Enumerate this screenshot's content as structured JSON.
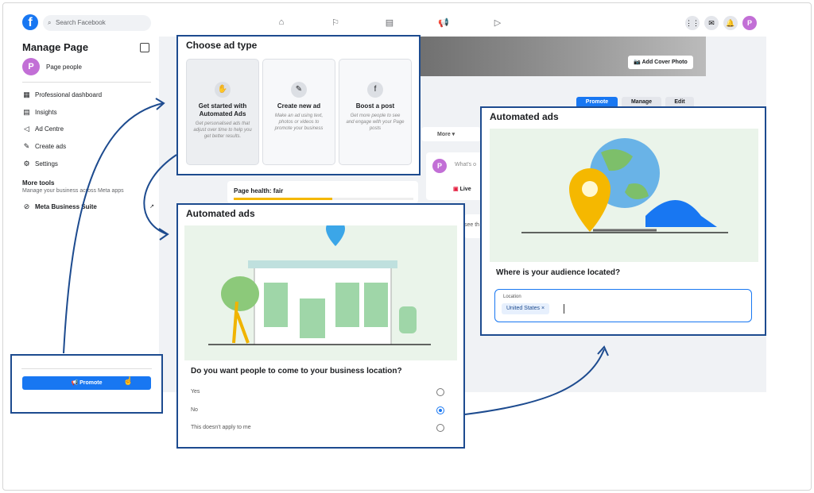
{
  "search": {
    "placeholder": "Search Facebook"
  },
  "topbar": {
    "avatar": "P"
  },
  "sidebar": {
    "title": "Manage Page",
    "page_name": "Page people",
    "avatar": "P",
    "items": [
      {
        "label": "Professional dashboard",
        "icon": "dashboard-icon"
      },
      {
        "label": "Insights",
        "icon": "insights-icon"
      },
      {
        "label": "Ad Centre",
        "icon": "megaphone-icon"
      },
      {
        "label": "Create ads",
        "icon": "edit-icon"
      },
      {
        "label": "Settings",
        "icon": "gear-icon"
      }
    ],
    "more_tools": "More tools",
    "more_tools_sub": "Manage your business across Meta apps",
    "meta_suite": "Meta Business Suite"
  },
  "cover": {
    "add_cover": "Add Cover Photo"
  },
  "header_buttons": {
    "promote": "Promote",
    "manage": "Manage",
    "edit": "Edit"
  },
  "tabs": {
    "more": "More"
  },
  "composer": {
    "placeholder": "What's o",
    "avatar": "P",
    "live": "Live",
    "partial": "see th"
  },
  "page_health": {
    "label": "Page health: fair"
  },
  "choose_ad": {
    "title": "Choose ad type",
    "tiles": [
      {
        "title": "Get started with Automated Ads",
        "desc": "Get personalised ads that adjust over time to help you get better results."
      },
      {
        "title": "Create new ad",
        "desc": "Make an ad using text, photos or videos to promote your business"
      },
      {
        "title": "Boost a post",
        "desc": "Get more people to see and engage with your Page posts"
      }
    ]
  },
  "automated_left": {
    "title": "Automated ads",
    "question": "Do you want people to come to your business location?",
    "options": [
      "Yes",
      "No",
      "This doesn't apply to me"
    ],
    "selected": "No"
  },
  "automated_right": {
    "title": "Automated ads",
    "question": "Where is your audience located?",
    "location_label": "Location",
    "chip": "United States"
  },
  "promote_button": {
    "label": "Promote"
  },
  "colors": {
    "brand": "#1877f2",
    "frame_border": "#1d4b8f",
    "health_bar": "#f5b800"
  }
}
